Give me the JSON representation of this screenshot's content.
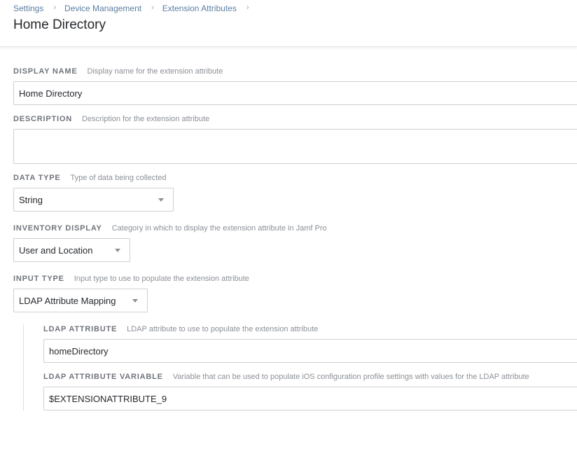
{
  "breadcrumb": {
    "items": [
      "Settings",
      "Device Management",
      "Extension Attributes"
    ],
    "separator": "›"
  },
  "page": {
    "title": "Home Directory"
  },
  "form": {
    "display_name": {
      "label": "DISPLAY NAME",
      "hint": "Display name for the extension attribute",
      "value": "Home Directory"
    },
    "description": {
      "label": "DESCRIPTION",
      "hint": "Description for the extension attribute",
      "value": ""
    },
    "data_type": {
      "label": "DATA TYPE",
      "hint": "Type of data being collected",
      "value": "String"
    },
    "inventory_display": {
      "label": "INVENTORY DISPLAY",
      "hint": "Category in which to display the extension attribute in Jamf Pro",
      "value": "User and Location"
    },
    "input_type": {
      "label": "INPUT TYPE",
      "hint": "Input type to use to populate the extension attribute",
      "value": "LDAP Attribute Mapping"
    },
    "ldap_attribute": {
      "label": "LDAP ATTRIBUTE",
      "hint": "LDAP attribute to use to populate the extension attribute",
      "value": "homeDirectory"
    },
    "ldap_attribute_variable": {
      "label": "LDAP ATTRIBUTE VARIABLE",
      "hint": "Variable that can be used to populate iOS configuration profile settings with values for the LDAP attribute",
      "value": "$EXTENSIONATTRIBUTE_9"
    }
  },
  "colors": {
    "link": "#5b7ea3",
    "title": "#25282d",
    "label": "#6f747b",
    "border": "#ccd0d5"
  }
}
